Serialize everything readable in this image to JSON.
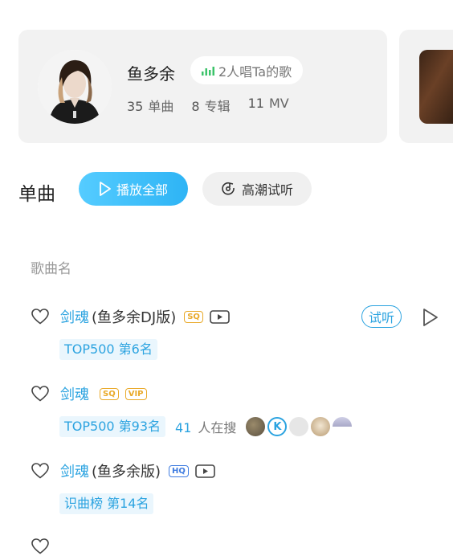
{
  "artist": {
    "name": "鱼多余",
    "badge": "2人唱Ta的歌",
    "stats": [
      {
        "num": "35",
        "label": "单曲"
      },
      {
        "num": "8",
        "label": "专辑"
      },
      {
        "num": "11",
        "label": "MV"
      }
    ]
  },
  "section": {
    "title": "单曲",
    "play_all": "播放全部",
    "climax": "高潮试听"
  },
  "list": {
    "header": "歌曲名",
    "songs": [
      {
        "title": "剑魂",
        "suffix": "(鱼多余DJ版)",
        "quality": "SQ",
        "rank": "TOP500 第6名",
        "listen": "试听"
      },
      {
        "title": "剑魂",
        "quality": "SQ",
        "vip": "VIP",
        "rank": "TOP500 第93名",
        "search_count": "41",
        "search_text": "人在搜",
        "k_label": "K"
      },
      {
        "title": "剑魂",
        "suffix": "(鱼多余版)",
        "quality": "HQ",
        "rank": "识曲榜 第14名"
      }
    ]
  },
  "colors": {
    "accent": "#2ba3e0",
    "gold": "#e9a928",
    "hq_blue": "#3f7ce0"
  }
}
